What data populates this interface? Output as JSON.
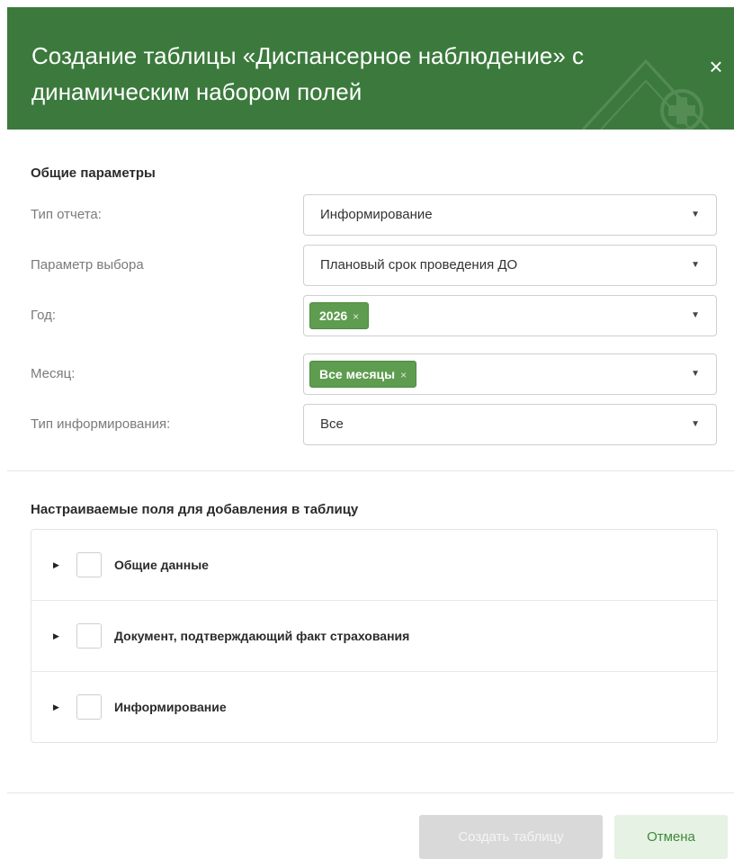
{
  "dialog": {
    "title": "Создание таблицы «Диспансерное наблюдение» с динамическим набором полей",
    "close_symbol": "×"
  },
  "general": {
    "heading": "Общие параметры",
    "fields": [
      {
        "label": "Тип отчета:",
        "value": "Информирование",
        "icon": "caret-down-icon"
      },
      {
        "label": "Параметр выбора",
        "value": "Плановый срок проведения ДО",
        "icon": "caret-down-icon"
      },
      {
        "label": "Год:",
        "tag": "2026",
        "tag_remove": "×",
        "icon": "caret-down-icon"
      },
      {
        "label": "Месяц:",
        "tag": "Все месяцы",
        "tag_remove": "×",
        "icon": "caret-down-icon"
      },
      {
        "label": "Тип информирования:",
        "value": "Все",
        "icon": "caret-down-icon"
      }
    ]
  },
  "custom_fields": {
    "heading": "Настраиваемые поля для добавления в таблицу",
    "items": [
      {
        "label": "Общие данные",
        "checked": false
      },
      {
        "label": "Документ, подтверждающий факт страхования",
        "checked": false
      },
      {
        "label": "Информирование",
        "checked": false
      }
    ]
  },
  "footer": {
    "create_label": "Создать таблицу",
    "cancel_label": "Отмена"
  },
  "colors": {
    "header_bg": "#3b7a3c",
    "tag_bg": "#5e9c4f",
    "create_disabled_bg": "#d9d9d9",
    "cancel_bg": "#e6f2e3",
    "cancel_text": "#3c8a3a"
  }
}
